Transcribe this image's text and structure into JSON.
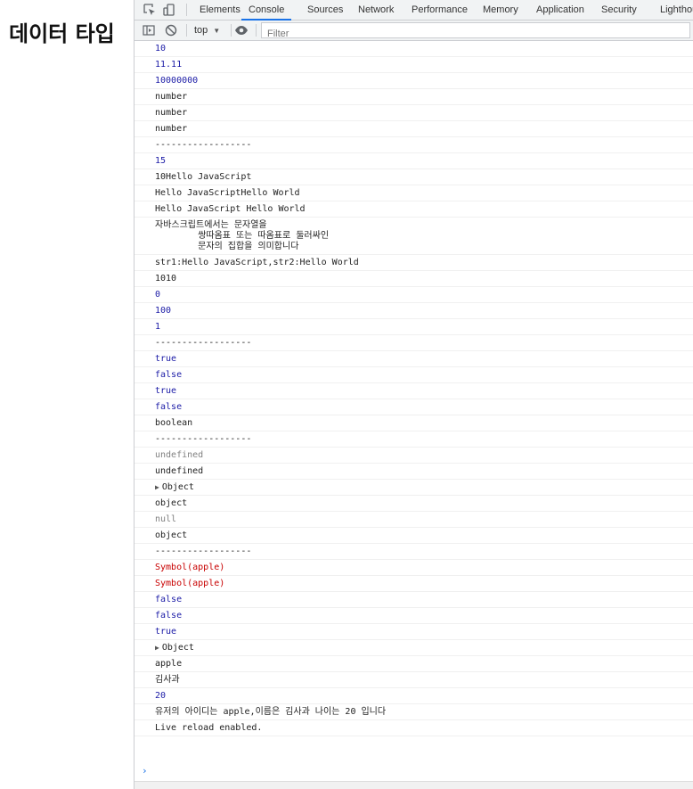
{
  "page": {
    "heading": "데이터 타입"
  },
  "devtools": {
    "tabs": [
      "Elements",
      "Console",
      "Sources",
      "Network",
      "Performance",
      "Memory",
      "Application",
      "Security",
      "Lighthouse"
    ],
    "active_tab": "Console",
    "context": "top",
    "filter_placeholder": "Filter"
  },
  "console": {
    "lines": [
      {
        "text": "10",
        "kind": "num"
      },
      {
        "text": "11.11",
        "kind": "num"
      },
      {
        "text": "10000000",
        "kind": "num"
      },
      {
        "text": "number",
        "kind": "str"
      },
      {
        "text": "number",
        "kind": "str"
      },
      {
        "text": "number",
        "kind": "str"
      },
      {
        "text": "------------------",
        "kind": "str"
      },
      {
        "text": "15",
        "kind": "num"
      },
      {
        "text": "10Hello JavaScript",
        "kind": "str"
      },
      {
        "text": "Hello JavaScriptHello World",
        "kind": "str"
      },
      {
        "text": "Hello JavaScript Hello World",
        "kind": "str"
      },
      {
        "text": "자바스크립트에서는 문자열을\n        쌍따옴표 또는 따옴표로 둘러싸인\n        문자의 집합을 의미합니다",
        "kind": "str"
      },
      {
        "text": "str1:Hello JavaScript,str2:Hello World",
        "kind": "str"
      },
      {
        "text": "1010",
        "kind": "str"
      },
      {
        "text": "0",
        "kind": "num"
      },
      {
        "text": "100",
        "kind": "num"
      },
      {
        "text": "1",
        "kind": "num"
      },
      {
        "text": "------------------",
        "kind": "str"
      },
      {
        "text": "true",
        "kind": "bool"
      },
      {
        "text": "false",
        "kind": "bool"
      },
      {
        "text": "true",
        "kind": "bool"
      },
      {
        "text": "false",
        "kind": "bool"
      },
      {
        "text": "boolean",
        "kind": "str"
      },
      {
        "text": "------------------",
        "kind": "str"
      },
      {
        "text": "undefined",
        "kind": "undef"
      },
      {
        "text": "undefined",
        "kind": "str"
      },
      {
        "text": "Object",
        "kind": "obj"
      },
      {
        "text": "object",
        "kind": "str"
      },
      {
        "text": "null",
        "kind": "undef"
      },
      {
        "text": "object",
        "kind": "str"
      },
      {
        "text": "------------------",
        "kind": "str"
      },
      {
        "text": "Symbol(apple)",
        "kind": "sym"
      },
      {
        "text": "Symbol(apple)",
        "kind": "sym"
      },
      {
        "text": "false",
        "kind": "bool"
      },
      {
        "text": "false",
        "kind": "bool"
      },
      {
        "text": "true",
        "kind": "bool"
      },
      {
        "text": "Object",
        "kind": "obj"
      },
      {
        "text": "apple",
        "kind": "str"
      },
      {
        "text": "김사과",
        "kind": "str"
      },
      {
        "text": "20",
        "kind": "num"
      },
      {
        "text": "유저의 아이디는 apple,이름은 김사과 나이는 20 입니다",
        "kind": "str"
      },
      {
        "text": "Live reload enabled.",
        "kind": "str"
      }
    ],
    "prompt_symbol": "›"
  },
  "colors": {
    "accent": "#1a73e8",
    "number": "#1a1aa6",
    "symbol": "#c80000",
    "muted": "#808080"
  },
  "icons": [
    "inspect-icon",
    "device-toggle-icon",
    "sidebar-toggle-icon",
    "clear-console-icon",
    "eye-icon"
  ]
}
